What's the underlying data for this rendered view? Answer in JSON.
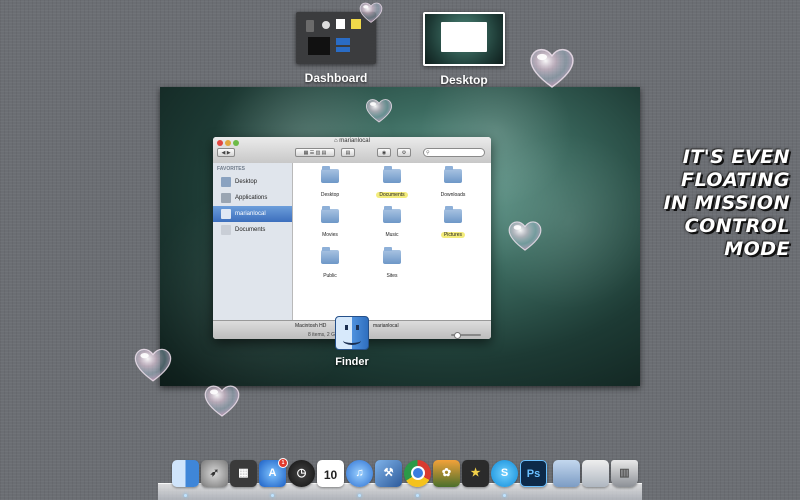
{
  "spaces": {
    "dashboard": {
      "label": "Dashboard"
    },
    "desktop": {
      "label": "Desktop"
    }
  },
  "finder_window": {
    "title": "marianlocal",
    "search_placeholder": "",
    "sidebar": {
      "header": "FAVORITES",
      "items": [
        {
          "label": "Desktop",
          "selected": false
        },
        {
          "label": "Applications",
          "selected": false
        },
        {
          "label": "marianlocal",
          "selected": true
        },
        {
          "label": "Documents",
          "selected": false
        }
      ]
    },
    "files": [
      {
        "label": "Desktop",
        "highlighted": false
      },
      {
        "label": "Documents",
        "highlighted": true
      },
      {
        "label": "Downloads",
        "highlighted": false
      },
      {
        "label": "Movies",
        "highlighted": false
      },
      {
        "label": "Music",
        "highlighted": false
      },
      {
        "label": "Pictures",
        "highlighted": true
      },
      {
        "label": "Public",
        "highlighted": false
      },
      {
        "label": "Sites",
        "highlighted": false
      }
    ],
    "path_bar": [
      "Macintosh HD",
      "marianlocal"
    ],
    "status": "8 items, 2 GB available"
  },
  "finder_app_label": "Finder",
  "caption": [
    "IT'S EVEN",
    "FLOATING",
    "IN MISSION",
    "CONTROL",
    "MODE"
  ],
  "dock": {
    "items": [
      {
        "name": "finder-icon",
        "running": true
      },
      {
        "name": "launchpad-icon",
        "running": false
      },
      {
        "name": "mission-control-icon",
        "running": false
      },
      {
        "name": "app-store-icon",
        "running": true,
        "badge": "1"
      },
      {
        "name": "dashboard-icon",
        "running": false
      },
      {
        "name": "calendar-icon",
        "running": false,
        "text": "10"
      },
      {
        "name": "itunes-icon",
        "running": true
      },
      {
        "name": "xcode-icon",
        "running": false
      },
      {
        "name": "chrome-icon",
        "running": true
      },
      {
        "name": "iphoto-icon",
        "running": false
      },
      {
        "name": "imovie-icon",
        "running": false
      },
      {
        "name": "skype-icon",
        "running": true
      },
      {
        "name": "photoshop-icon",
        "running": false,
        "text": "Ps"
      },
      {
        "name": "applications-folder-icon",
        "running": false
      },
      {
        "name": "documents-stack-icon",
        "running": false
      },
      {
        "name": "trash-icon",
        "running": false
      }
    ]
  }
}
